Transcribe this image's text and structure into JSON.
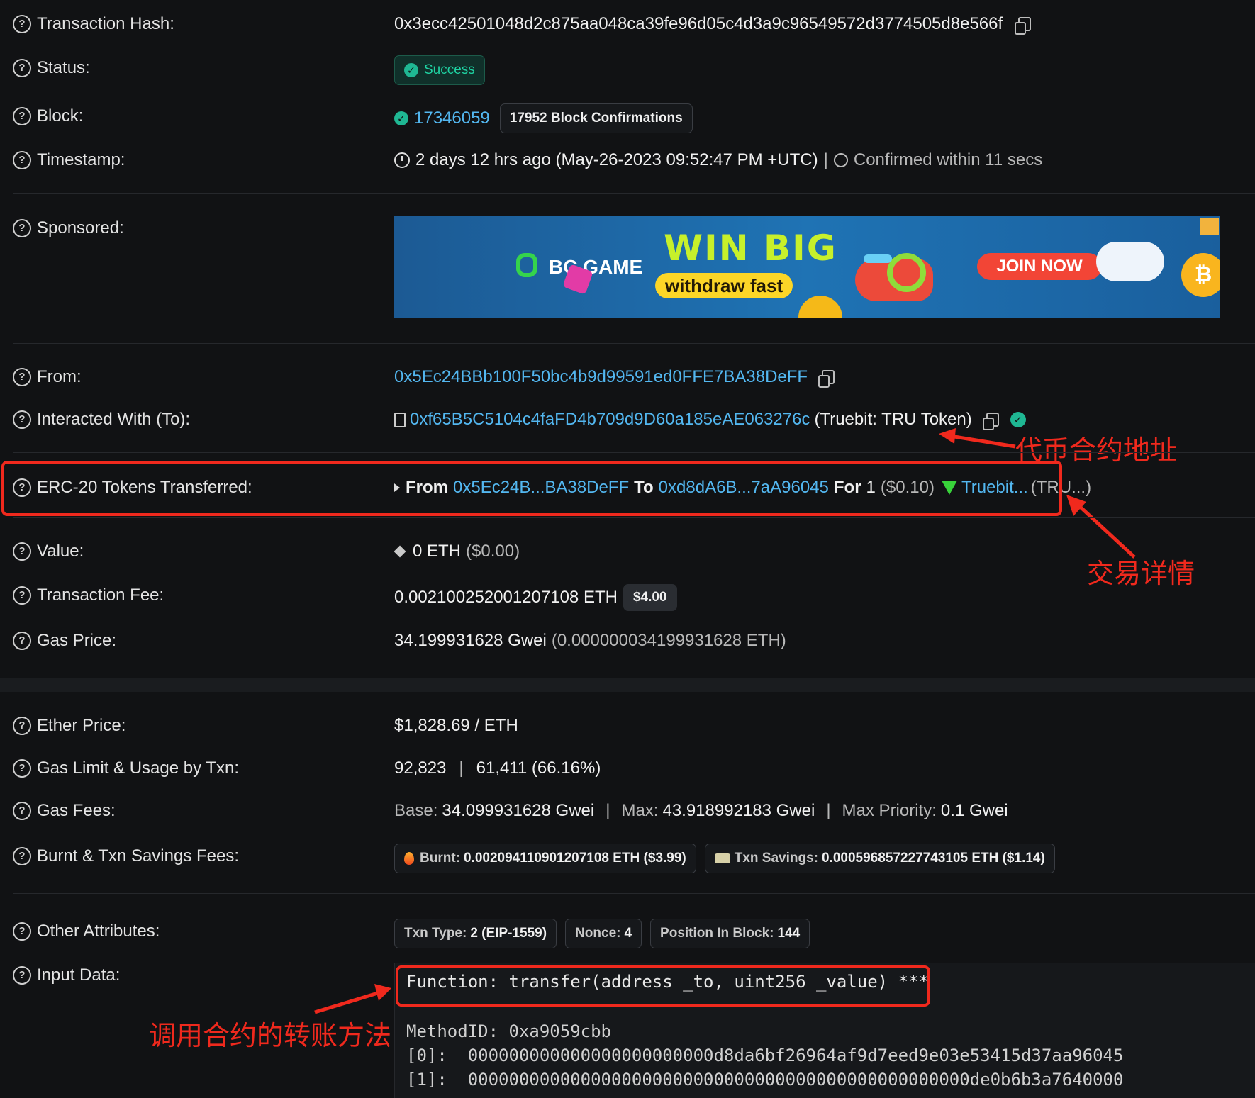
{
  "tx_hash": {
    "label": "Transaction Hash:",
    "value": "0x3ecc42501048d2c875aa048ca39fe96d05c4d3a9c96549572d3774505d8e566f"
  },
  "status": {
    "label": "Status:",
    "value": "Success"
  },
  "block": {
    "label": "Block:",
    "number": "17346059",
    "confirmations": "17952 Block Confirmations"
  },
  "timestamp": {
    "label": "Timestamp:",
    "value": "2 days 12 hrs ago (May-26-2023 09:52:47 PM +UTC)",
    "divider": "|",
    "confirmed": "Confirmed within 11 secs"
  },
  "sponsored": {
    "label": "Sponsored:",
    "ad": {
      "brand": "BC.GAME",
      "headline": "WIN BIG",
      "tagline": "withdraw fast",
      "cta": "JOIN NOW"
    }
  },
  "from": {
    "label": "From:",
    "address": "0x5Ec24BBb100F50bc4b9d99591ed0FFE7BA38DeFF"
  },
  "to": {
    "label": "Interacted With (To):",
    "address": "0xf65B5C5104c4faFD4b709d9D60a185eAE063276c",
    "name": "(Truebit: TRU Token)"
  },
  "erc20": {
    "label": "ERC-20 Tokens Transferred:",
    "from_word": "From",
    "from_addr": "0x5Ec24B...BA38DeFF",
    "to_word": "To",
    "to_addr": "0xd8dA6B...7aA96045",
    "for_word": "For",
    "amount": "1",
    "usd": "($0.10)",
    "token": "Truebit...",
    "symbol": "(TRU...)"
  },
  "value": {
    "label": "Value:",
    "eth": "0 ETH",
    "usd": "($0.00)"
  },
  "fee": {
    "label": "Transaction Fee:",
    "eth": "0.002100252001207108 ETH",
    "usd": "$4.00"
  },
  "gas_price": {
    "label": "Gas Price:",
    "gwei": "34.199931628 Gwei",
    "eth": "(0.000000034199931628 ETH)"
  },
  "ether_price": {
    "label": "Ether Price:",
    "value": "$1,828.69 / ETH"
  },
  "gas_limit": {
    "label": "Gas Limit & Usage by Txn:",
    "limit": "92,823",
    "divider": "|",
    "usage": "61,411 (66.16%)"
  },
  "gas_fees": {
    "label": "Gas Fees:",
    "base_k": "Base:",
    "base_v": "34.099931628 Gwei",
    "max_k": "Max:",
    "max_v": "43.918992183 Gwei",
    "prio_k": "Max Priority:",
    "prio_v": "0.1 Gwei",
    "divider": "|"
  },
  "burnt": {
    "label": "Burnt & Txn Savings Fees:",
    "burnt_k": "Burnt:",
    "burnt_v": "0.002094110901207108 ETH ($3.99)",
    "save_k": "Txn Savings:",
    "save_v": "0.000596857227743105 ETH ($1.14)"
  },
  "other": {
    "label": "Other Attributes:",
    "type_k": "Txn Type:",
    "type_v": "2 (EIP-1559)",
    "nonce_k": "Nonce:",
    "nonce_v": "4",
    "pos_k": "Position In Block:",
    "pos_v": "144"
  },
  "input": {
    "label": "Input Data:",
    "function": "Function: transfer(address _to, uint256 _value) ***",
    "method": "MethodID: 0xa9059cbb",
    "p0": "[0]:  000000000000000000000000d8da6bf26964af9d7eed9e03e53415d37aa96045",
    "p1": "[1]:  0000000000000000000000000000000000000000000000000de0b6b3a7640000"
  },
  "annotations": {
    "contract_address": "代币合约地址",
    "tx_details": "交易详情",
    "call_method": "调用合约的转账方法"
  },
  "colors": {
    "annotation": "#f0291d",
    "link": "#53b7f0",
    "success": "#1fb793"
  }
}
